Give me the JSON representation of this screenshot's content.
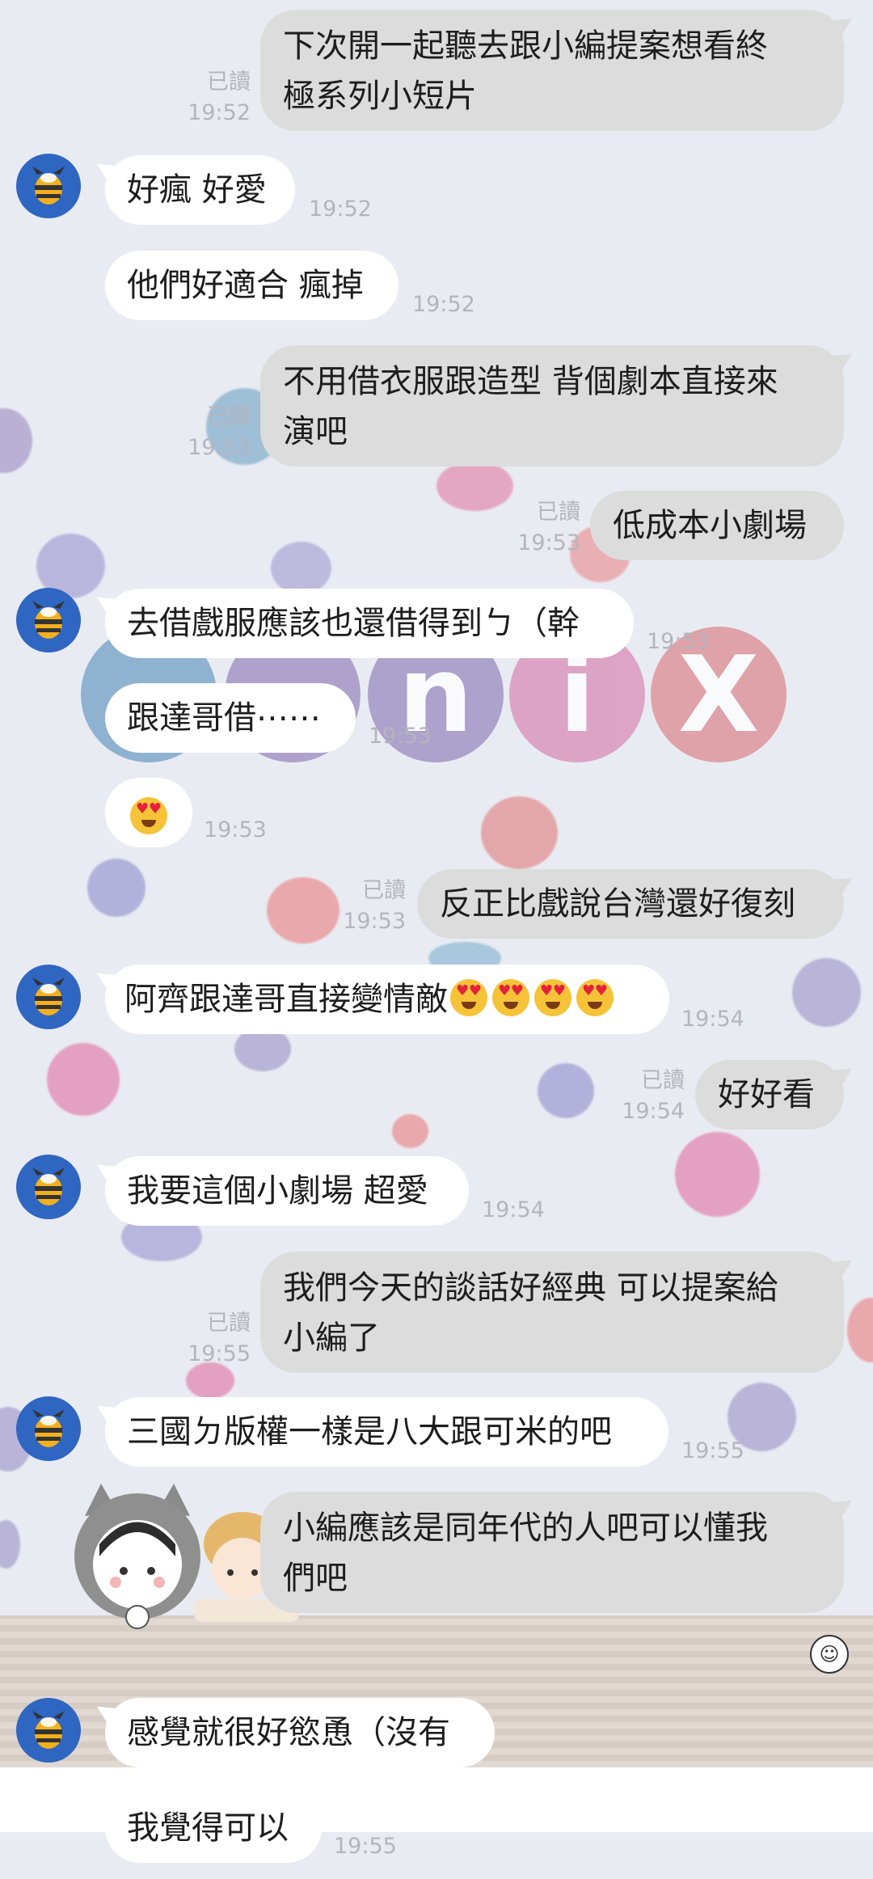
{
  "chat": {
    "read_label": "已讀",
    "messages": [
      {
        "text_lines": [
          "下次開一起聽去跟小編提案想看終",
          "極系列小短片"
        ],
        "time": "19:52"
      },
      {
        "text": "好瘋 好愛",
        "time": "19:52"
      },
      {
        "text": "他們好適合 瘋掉",
        "time": "19:52"
      },
      {
        "text_lines": [
          "不用借衣服跟造型  背個劇本直接來",
          "演吧"
        ],
        "time": "19:53"
      },
      {
        "text": "低成本小劇場",
        "time": "19:53"
      },
      {
        "text": "去借戲服應該也還借得到ㄅ（幹",
        "time": "19:53"
      },
      {
        "text": "跟達哥借⋯⋯",
        "time": "19:53"
      },
      {
        "emoji": "heart-eyes",
        "time": "19:53"
      },
      {
        "text": "反正比戲說台灣還好復刻",
        "time": "19:53"
      },
      {
        "text": "阿齊跟達哥直接變情敵",
        "time": "19:54"
      },
      {
        "text": "好好看",
        "time": "19:54"
      },
      {
        "text": "我要這個小劇場 超愛",
        "time": "19:54"
      },
      {
        "text_lines": [
          "我們今天的談話好經典  可以提案給",
          "小編了"
        ],
        "time": "19:55"
      },
      {
        "text": "三國ㄉ版權一樣是八大跟可米的吧",
        "time": "19:55"
      },
      {
        "text_lines": [
          "小編應該是同年代的人吧可以懂我",
          "們吧"
        ],
        "time": ""
      },
      {
        "text": "感覺就很好慾恿（沒有",
        "time": ""
      },
      {
        "text": "我覺得可以",
        "time": "19:55"
      }
    ]
  },
  "decor": {
    "letters": [
      "n",
      "i",
      "X"
    ]
  },
  "colors": {
    "avatar": "#2f66c2",
    "outgoing_bubble": "#dcdcdc",
    "incoming_bubble": "#ffffff"
  }
}
